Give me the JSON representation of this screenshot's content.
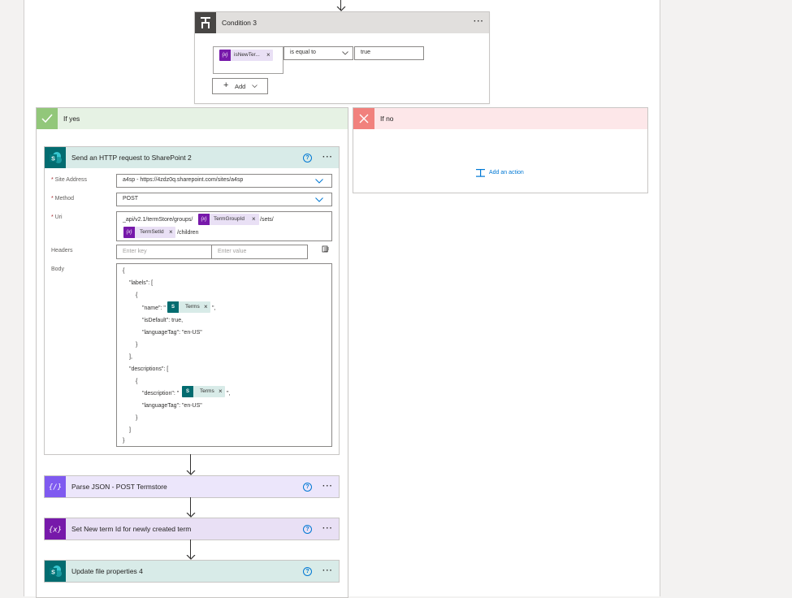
{
  "condition": {
    "title": "Condition 3",
    "operand_token": "isNewTer...",
    "operator": "is equal to",
    "value": "true",
    "add_label": "Add"
  },
  "if_yes": {
    "title": "If yes"
  },
  "if_no": {
    "title": "If no",
    "add_action_label": "Add an action"
  },
  "http_action": {
    "title": "Send an HTTP request to SharePoint 2",
    "site_address_label": "Site Address",
    "site_address_value": "a4sp - https://4zdz0q.sharepoint.com/sites/a4sp",
    "method_label": "Method",
    "method_value": "POST",
    "uri_label": "Uri",
    "uri_prefix": "_api/v2.1/termStore/groups/",
    "uri_token_group": "TermGroupId",
    "uri_mid": "/sets/",
    "uri_token_set": "TermSetId",
    "uri_suffix": "/children",
    "headers_label": "Headers",
    "headers_key_placeholder": "Enter key",
    "headers_value_placeholder": "Enter value",
    "body_label": "Body",
    "body_lines": {
      "l1": "{",
      "l2": "\"labels\": [",
      "l3": "{",
      "l4a": "\"name\": \"",
      "l4_token": "Terms",
      "l4b": "\",",
      "l5": "\"isDefault\": true,",
      "l6": "\"languageTag\": \"en-US\"",
      "l7": "}",
      "l8": "],",
      "l9": "\"descriptions\": [",
      "l10": "{",
      "l11a": "\"description\": \"",
      "l11_token": "Terms",
      "l11b": "\",",
      "l12": "\"languageTag\": \"en-US\"",
      "l13": "}",
      "l14": "]",
      "l15": "}"
    }
  },
  "parse_json": {
    "title": "Parse JSON - POST Termstore"
  },
  "set_var": {
    "title": "Set New term Id for newly created term"
  },
  "update_file": {
    "title": "Update file properties 4"
  },
  "colors": {
    "condition_header": "#e1dfdd",
    "yes_header": "#e6f2e4",
    "no_header": "#fde7e9",
    "sharepoint_teal": "#036c70",
    "variable_purple": "#7719aa",
    "parse_json_purple": "#7f5af0"
  },
  "icons": {
    "condition": "condition-icon",
    "yes": "checkmark-icon",
    "no": "close-icon",
    "sharepoint": "sharepoint-icon",
    "variable": "variable-icon",
    "parse_json": "parse-json-icon",
    "add_action": "add-action-icon",
    "help": "help-icon",
    "more": "more-options-icon",
    "chevron": "chevron-down-icon",
    "headers_toggle": "text-mode-icon"
  }
}
